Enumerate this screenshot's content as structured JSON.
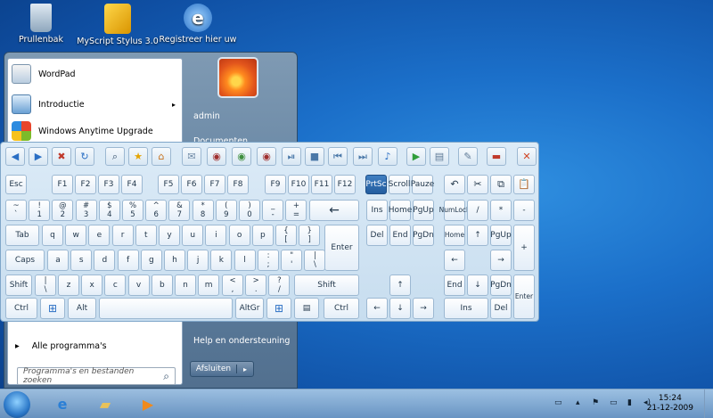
{
  "desktop": {
    "icons": [
      {
        "label": "Prullenbak",
        "icon": "recycle-bin-icon",
        "color": "#9fb5c8"
      },
      {
        "label": "MyScript Stylus 3.0",
        "icon": "stylus-icon",
        "color": "#e9b100"
      },
      {
        "label": "Registreer hier uw",
        "icon": "internet-explorer-icon",
        "color": "#2f7fd6"
      }
    ]
  },
  "startmenu": {
    "programs": [
      {
        "label": "WordPad",
        "icon": "wordpad-icon",
        "submenu": false
      },
      {
        "label": "Introductie",
        "icon": "introduction-icon",
        "submenu": true,
        "arrow": "▸"
      },
      {
        "label": "Windows Anytime Upgrade",
        "icon": "windows-icon",
        "submenu": false
      }
    ],
    "all_programs": "Alle programma's",
    "all_programs_arrow": "▸",
    "search_placeholder": "Programma's en bestanden zoeken",
    "search_icon": "⌕",
    "user": "admin",
    "documents": "Documenten",
    "help": "Help en ondersteuning",
    "shutdown_label": "Afsluiten",
    "shutdown_arrow": "▸"
  },
  "keyboard": {
    "toolbar": [
      {
        "name": "back-icon",
        "glyph": "◀",
        "color": "#2a6fc4"
      },
      {
        "name": "forward-icon",
        "glyph": "▶",
        "color": "#2a6fc4"
      },
      {
        "name": "stop-icon",
        "glyph": "✖",
        "color": "#c0392b"
      },
      {
        "name": "refresh-icon",
        "glyph": "↻",
        "color": "#2a6fc4"
      },
      {
        "name": "search-icon",
        "glyph": "⌕",
        "color": "#35506a"
      },
      {
        "name": "favorites-icon",
        "glyph": "★",
        "color": "#e5a400"
      },
      {
        "name": "home-icon",
        "glyph": "⌂",
        "color": "#c9721c"
      },
      {
        "name": "mail-icon",
        "glyph": "✉",
        "color": "#6f8aa6"
      },
      {
        "name": "mute-icon",
        "glyph": "◉",
        "color": "#a03030"
      },
      {
        "name": "volume-up-icon",
        "glyph": "◉",
        "color": "#3f8f3f"
      },
      {
        "name": "volume-down-icon",
        "glyph": "◉",
        "color": "#a03030"
      },
      {
        "name": "play-pause-icon",
        "glyph": "⏯",
        "color": "#4a78a8"
      },
      {
        "name": "media-stop-icon",
        "glyph": "■",
        "color": "#4a78a8"
      },
      {
        "name": "previous-track-icon",
        "glyph": "⏮",
        "color": "#4a78a8"
      },
      {
        "name": "next-track-icon",
        "glyph": "⏭",
        "color": "#4a78a8"
      },
      {
        "name": "music-icon",
        "glyph": "♪",
        "color": "#2a6fc4"
      },
      {
        "name": "run-icon",
        "glyph": "▶",
        "color": "#2f9e3a"
      },
      {
        "name": "settings-icon",
        "glyph": "▤",
        "color": "#5f7a96"
      },
      {
        "name": "notes-icon",
        "glyph": "✎",
        "color": "#5f7a96"
      },
      {
        "name": "language-flag-icon",
        "glyph": "▬",
        "color": "#c03a2b"
      },
      {
        "name": "close-icon",
        "glyph": "✕",
        "color": "#d04422"
      }
    ],
    "fkeys": {
      "esc": "Esc",
      "f": [
        "F1",
        "F2",
        "F3",
        "F4",
        "F5",
        "F6",
        "F7",
        "F8",
        "F9",
        "F10",
        "F11",
        "F12"
      ],
      "nav": [
        "PrtSc",
        "Scroll",
        "Pauze"
      ],
      "edit_icons": [
        {
          "name": "undo-icon",
          "glyph": "↶"
        },
        {
          "name": "cut-icon",
          "glyph": "✂"
        },
        {
          "name": "copy-icon",
          "glyph": "⧉"
        },
        {
          "name": "paste-icon",
          "glyph": "📋"
        }
      ]
    },
    "row1": [
      [
        "~",
        "`"
      ],
      [
        "!",
        "1"
      ],
      [
        "@",
        "2"
      ],
      [
        "#",
        "3"
      ],
      [
        "$",
        "4"
      ],
      [
        "%",
        "5"
      ],
      [
        "^",
        "6"
      ],
      [
        "&",
        "7"
      ],
      [
        "*",
        "8"
      ],
      [
        "(",
        "9"
      ],
      [
        ")",
        "0"
      ],
      [
        "_",
        "-"
      ],
      [
        "+",
        "="
      ]
    ],
    "backspace": "←",
    "row2_start": "Tab",
    "row2": [
      "q",
      "w",
      "e",
      "r",
      "t",
      "y",
      "u",
      "i",
      "o",
      "p"
    ],
    "row2_br": [
      [
        "{",
        "["
      ],
      [
        "}",
        "]"
      ]
    ],
    "row3_start": "Caps",
    "row3": [
      "a",
      "s",
      "d",
      "f",
      "g",
      "h",
      "j",
      "k",
      "l"
    ],
    "row3_p": [
      [
        ":",
        ";"
      ],
      [
        "\"",
        "'"
      ],
      [
        "|",
        "\\"
      ]
    ],
    "enter": "Enter",
    "row4_start": "Shift",
    "row4_bs": [
      "|",
      "\\"
    ],
    "row4": [
      "z",
      "x",
      "c",
      "v",
      "b",
      "n",
      "m"
    ],
    "row4_p": [
      [
        "<",
        ","
      ],
      [
        ">",
        "."
      ],
      [
        "?",
        "/"
      ]
    ],
    "row4_end": "Shift",
    "row5": {
      "ctrl": "Ctrl",
      "alt": "Alt",
      "altgr": "AltGr",
      "ctrl_r": "Ctrl",
      "win": "⊞",
      "menu": "▤"
    },
    "navblock": [
      "Ins",
      "Home",
      "PgUp",
      "Del",
      "End",
      "PgDn"
    ],
    "arrows": {
      "up": "↑",
      "left": "←",
      "down": "↓",
      "right": "→"
    },
    "numpad": {
      "num": "NumLock",
      "div": "/",
      "mul": "*",
      "sub": "-",
      "home": "Home",
      "up": "↑",
      "pgup": "PgUp",
      "plus": "+",
      "left": "←",
      "right": "→",
      "end": "End",
      "down": "↓",
      "pgdn": "PgDn",
      "ins": "Ins",
      "del": "Del",
      "enter": "Enter"
    }
  },
  "taskbar": {
    "apps": [
      {
        "name": "internet-explorer-icon",
        "glyph": "e",
        "color": "#2a7fd6"
      },
      {
        "name": "explorer-folder-icon",
        "glyph": "▰",
        "color": "#e8c25a"
      },
      {
        "name": "media-player-icon",
        "glyph": "▶",
        "color": "#f08a1c"
      }
    ],
    "time": "15:24",
    "date": "21-12-2009",
    "tray": [
      {
        "name": "keyboard-tray-icon",
        "glyph": "▭"
      },
      {
        "name": "show-hidden-icon",
        "glyph": "▴"
      },
      {
        "name": "action-center-icon",
        "glyph": "⚑"
      },
      {
        "name": "display-icon",
        "glyph": "▭"
      },
      {
        "name": "network-icon",
        "glyph": "▮"
      },
      {
        "name": "volume-icon",
        "glyph": "◂)"
      }
    ]
  }
}
